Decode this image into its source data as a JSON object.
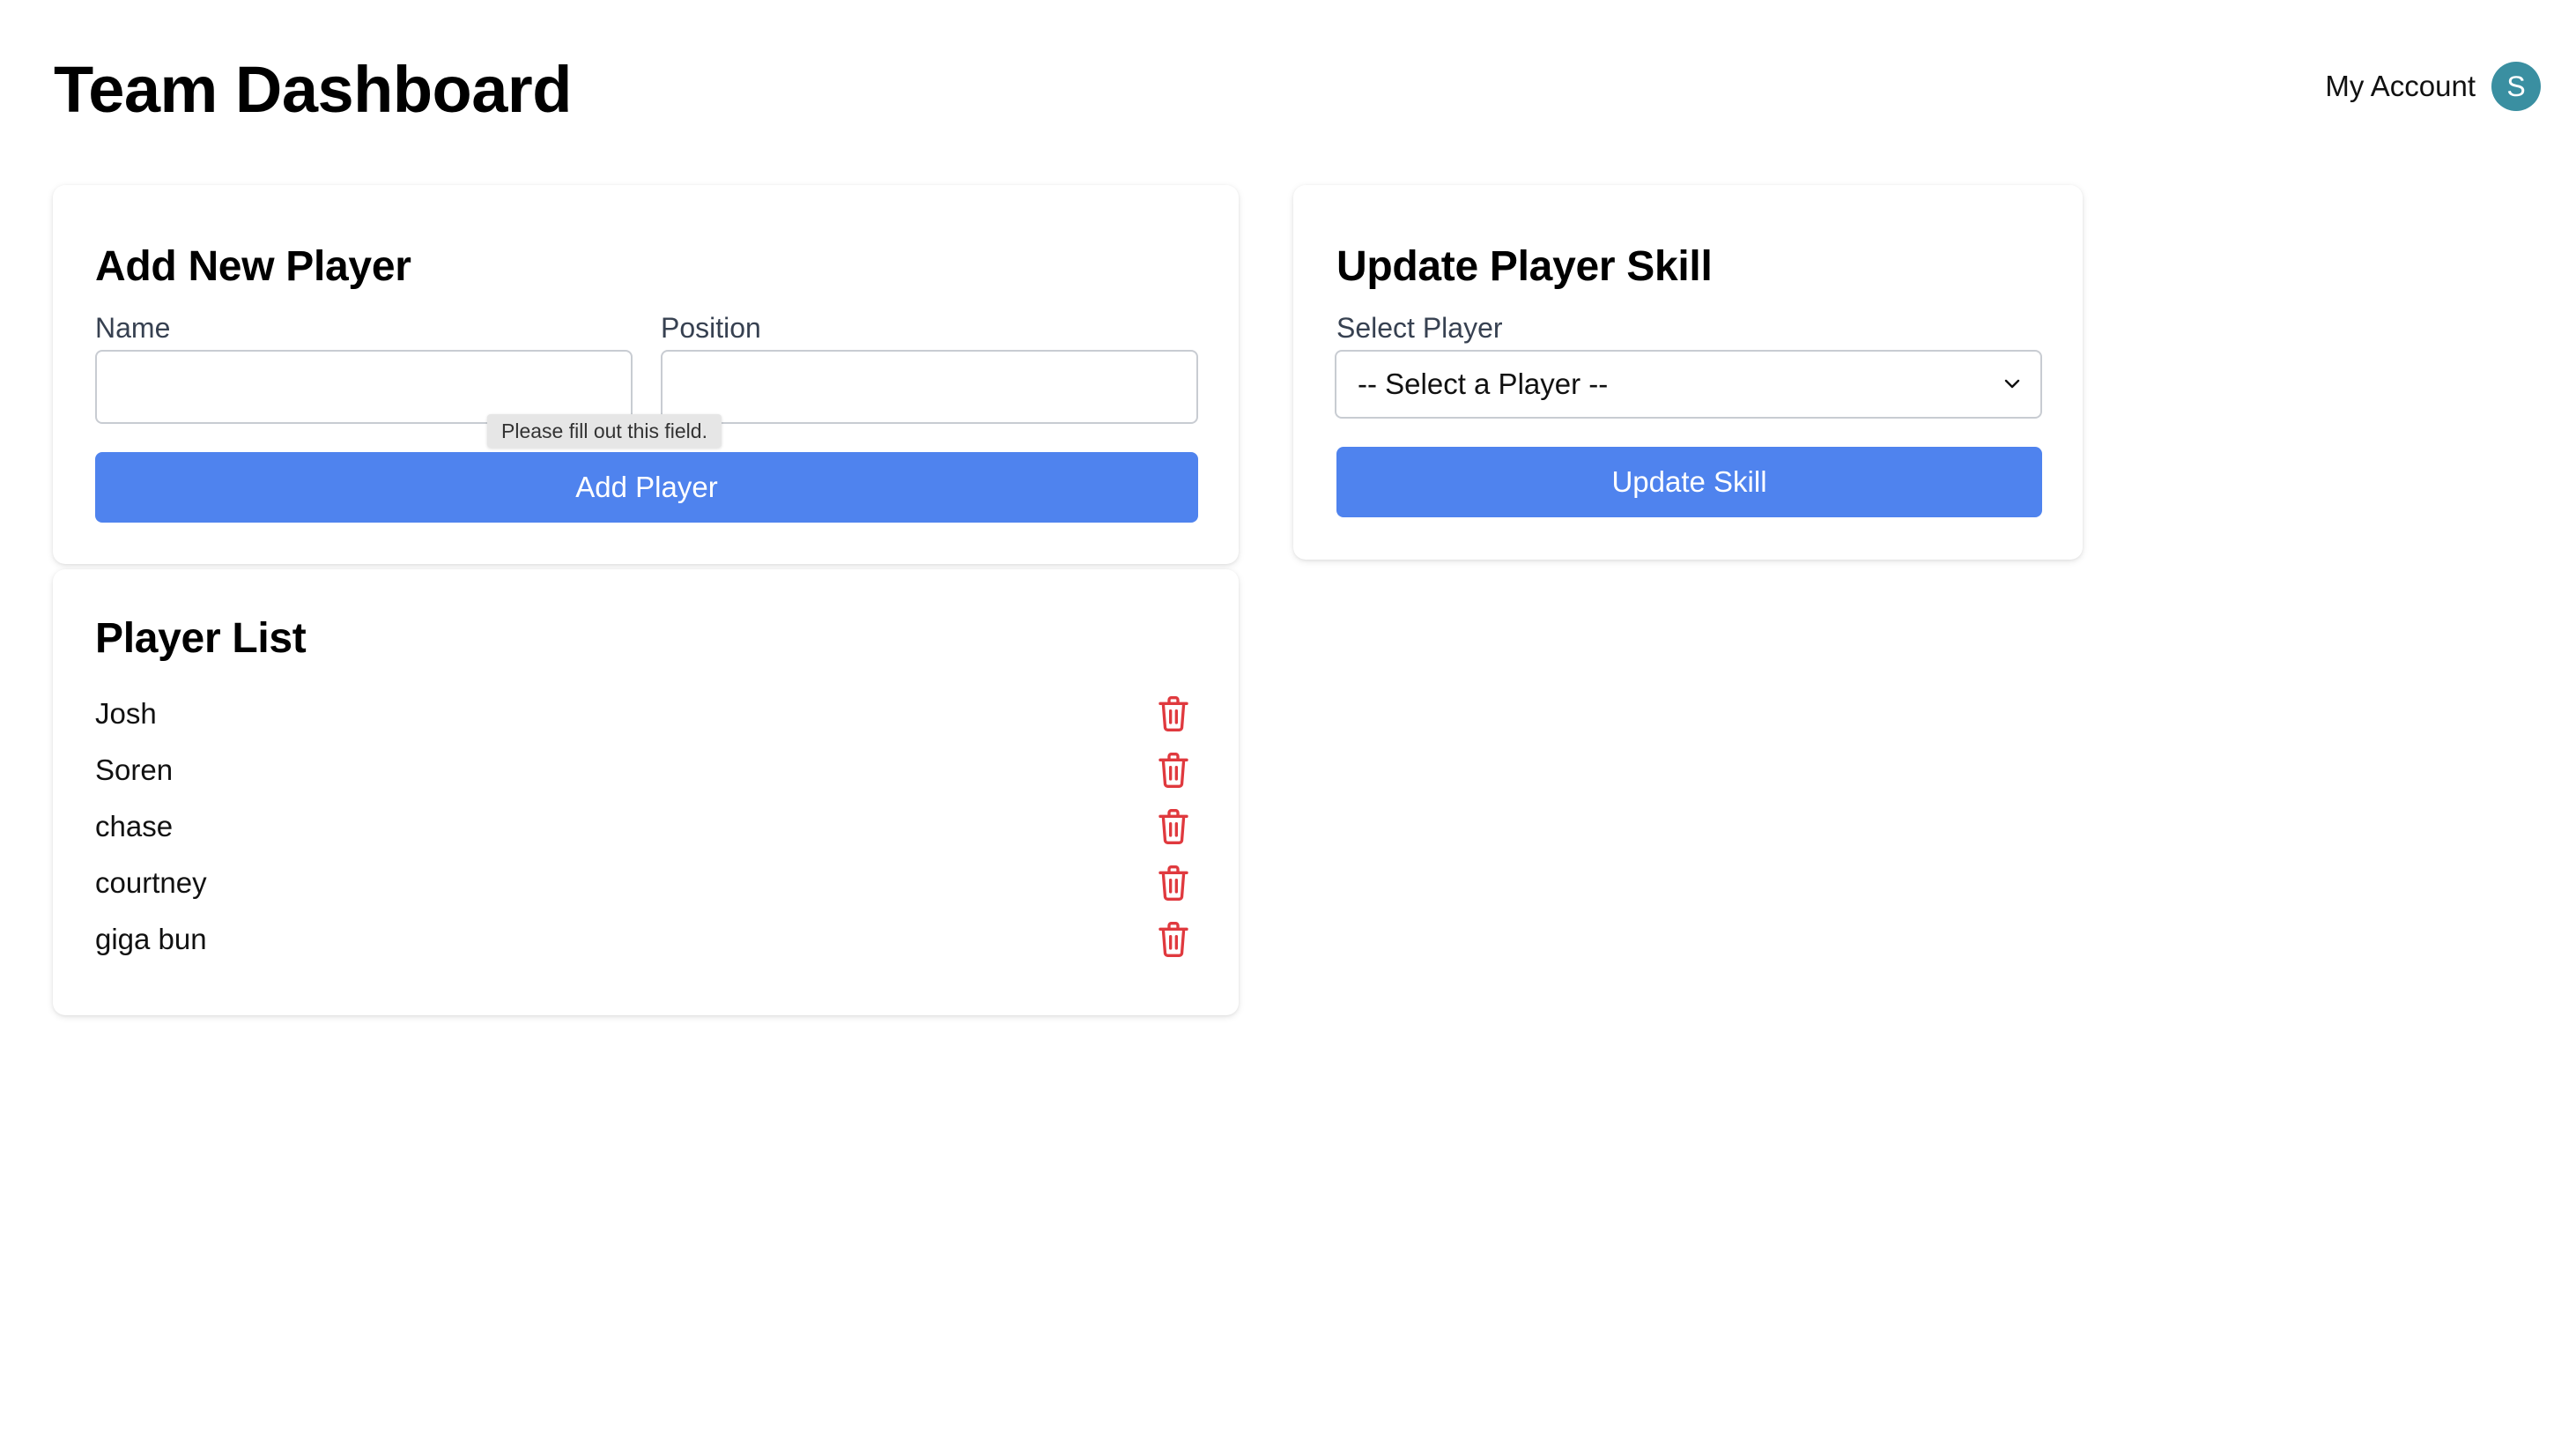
{
  "header": {
    "title": "Team Dashboard",
    "account_label": "My Account",
    "avatar_initial": "S"
  },
  "add_player": {
    "title": "Add New Player",
    "name_label": "Name",
    "name_value": "",
    "position_label": "Position",
    "position_value": "",
    "submit_label": "Add Player",
    "validation_tooltip": "Please fill out this field."
  },
  "update_skill": {
    "title": "Update Player Skill",
    "select_label": "Select Player",
    "select_value": "-- Select a Player --",
    "submit_label": "Update Skill"
  },
  "player_list": {
    "title": "Player List",
    "players": [
      {
        "name": "Josh"
      },
      {
        "name": "Soren"
      },
      {
        "name": "chase"
      },
      {
        "name": "courtney"
      },
      {
        "name": "giga bun"
      }
    ],
    "delete_icon": "trash-icon"
  },
  "colors": {
    "primary": "#4f83ee",
    "danger": "#e0393e",
    "avatar": "#3a8fa1"
  }
}
